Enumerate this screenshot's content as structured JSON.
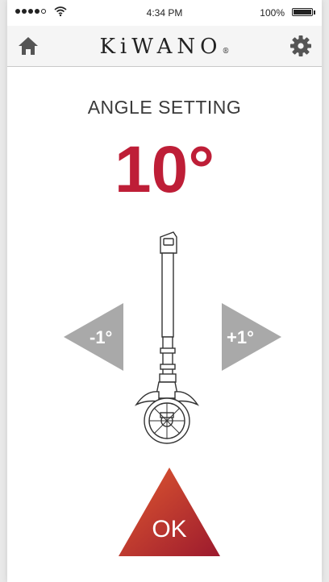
{
  "status_bar": {
    "time": "4:34 PM",
    "battery_percent": "100%",
    "signal_bars": 4,
    "signal_total": 5,
    "icons": [
      "signal-dots",
      "wifi-icon",
      "battery-icon"
    ]
  },
  "header": {
    "logo_text": "KiWANO",
    "logo_mark": "®",
    "home_icon": "home-icon",
    "settings_icon": "gear-icon"
  },
  "main": {
    "title": "ANGLE SETTING",
    "angle_value": "10°",
    "decrease_label": "-1°",
    "increase_label": "+1°",
    "ok_label": "OK"
  },
  "colors": {
    "accent_red": "#be1e37",
    "arrow_grey": "#a9a9a9",
    "ok_gradient_start": "#e05a30",
    "ok_gradient_end": "#9c1a2e"
  }
}
